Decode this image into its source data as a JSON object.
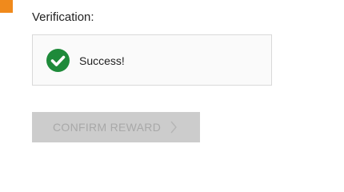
{
  "verification": {
    "label": "Verification:",
    "status_text": "Success!",
    "status_icon": "check-circle-icon",
    "status_color": "#1e8a3a"
  },
  "confirm": {
    "label": "CONFIRM REWARD",
    "icon": "chevron-right-icon",
    "disabled": true
  },
  "colors": {
    "accent": "#f08a1c",
    "button_disabled_bg": "#cccccc",
    "button_disabled_text": "#a8a8a8"
  }
}
